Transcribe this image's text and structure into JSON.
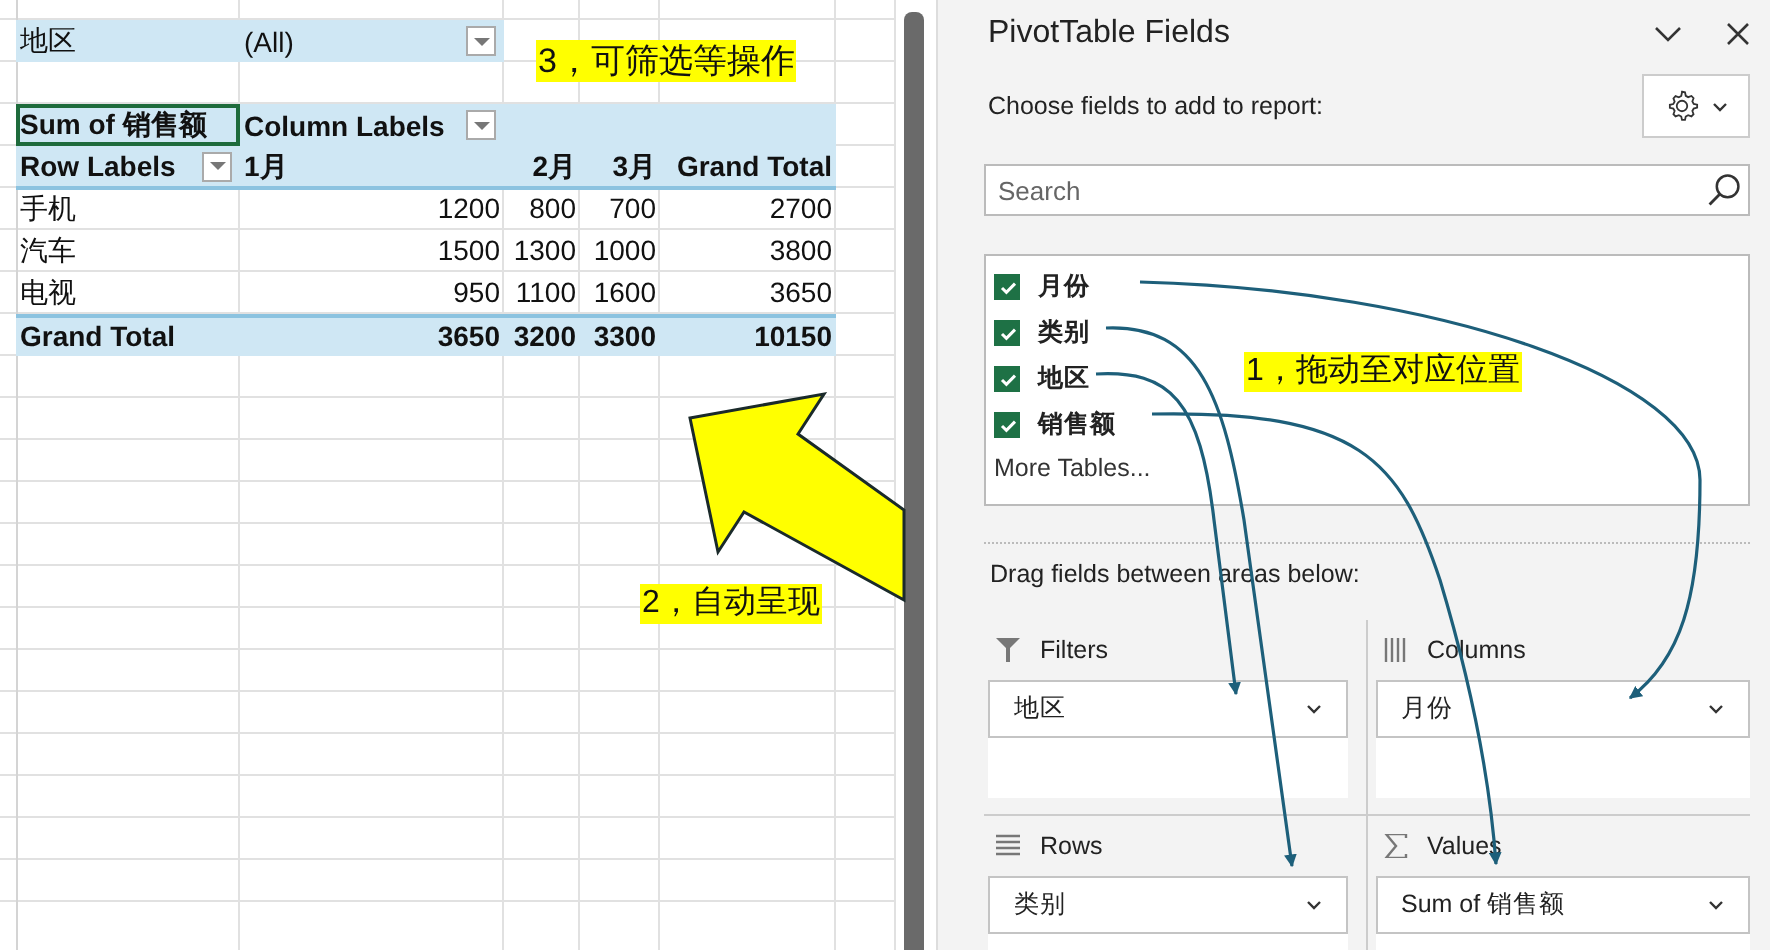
{
  "sheet": {
    "filter": {
      "field": "地区",
      "value": "(All)"
    },
    "pivot": {
      "value_field": {
        "text": "Sum of 销售额",
        "selected": true
      },
      "column_labels": "Column Labels",
      "row_labels": "Row Labels",
      "columns": [
        "1月",
        "2月",
        "3月",
        "Grand Total"
      ],
      "rows": [
        {
          "label": "手机",
          "values": [
            "1200",
            "800",
            "700",
            "2700"
          ]
        },
        {
          "label": "汽车",
          "values": [
            "1500",
            "1300",
            "1000",
            "3800"
          ]
        },
        {
          "label": "电视",
          "values": [
            "950",
            "1100",
            "1600",
            "3650"
          ]
        }
      ],
      "grand_total": {
        "label": "Grand Total",
        "values": [
          "3650",
          "3200",
          "3300",
          "10150"
        ]
      }
    }
  },
  "annotations": [
    {
      "text": "3，可筛选等操作"
    },
    {
      "text": "2，自动呈现"
    },
    {
      "text": "1，拖动至对应位置"
    }
  ],
  "panel": {
    "title": "PivotTable Fields",
    "subtitle": "Choose fields to add to report:",
    "search": {
      "placeholder": "Search"
    },
    "fields": [
      {
        "label": "月份",
        "checked": true
      },
      {
        "label": "类别",
        "checked": true
      },
      {
        "label": "地区",
        "checked": true
      },
      {
        "label": "销售额",
        "checked": true
      }
    ],
    "more_tables": "More Tables...",
    "areas_hint": "Drag fields between areas below:",
    "areas": [
      {
        "kind": "filters",
        "label": "Filters",
        "items": [
          "地区"
        ]
      },
      {
        "kind": "columns",
        "label": "Columns",
        "items": [
          "月份"
        ]
      },
      {
        "kind": "rows",
        "label": "Rows",
        "items": [
          "类别"
        ]
      },
      {
        "kind": "values",
        "label": "Values",
        "items": [
          "Sum of 销售额"
        ]
      }
    ]
  }
}
